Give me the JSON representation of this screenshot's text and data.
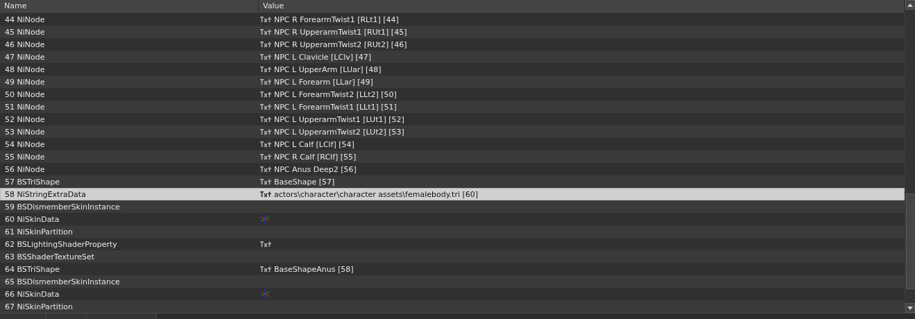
{
  "table": {
    "columns": [
      {
        "label": "Name"
      },
      {
        "label": "Value"
      }
    ],
    "rows": [
      {
        "name": "44 NiNode",
        "kind": "txt",
        "value": "NPC R ForearmTwist1 [RLt1] [44]",
        "selected": false
      },
      {
        "name": "45 NiNode",
        "kind": "txt",
        "value": "NPC R UpperarmTwist1 [RUt1] [45]",
        "selected": false
      },
      {
        "name": "46 NiNode",
        "kind": "txt",
        "value": "NPC R UpperarmTwist2 [RUt2] [46]",
        "selected": false
      },
      {
        "name": "47 NiNode",
        "kind": "txt",
        "value": "NPC L Clavicle [LClv] [47]",
        "selected": false
      },
      {
        "name": "48 NiNode",
        "kind": "txt",
        "value": "NPC L UpperArm [LUar] [48]",
        "selected": false
      },
      {
        "name": "49 NiNode",
        "kind": "txt",
        "value": "NPC L Forearm [LLar] [49]",
        "selected": false
      },
      {
        "name": "50 NiNode",
        "kind": "txt",
        "value": "NPC L ForearmTwist2 [LLt2] [50]",
        "selected": false
      },
      {
        "name": "51 NiNode",
        "kind": "txt",
        "value": "NPC L ForearmTwist1 [LLt1] [51]",
        "selected": false
      },
      {
        "name": "52 NiNode",
        "kind": "txt",
        "value": "NPC L UpperarmTwist1 [LUt1] [52]",
        "selected": false
      },
      {
        "name": "53 NiNode",
        "kind": "txt",
        "value": "NPC L UpperarmTwist2 [LUt2] [53]",
        "selected": false
      },
      {
        "name": "54 NiNode",
        "kind": "txt",
        "value": "NPC L Calf [LClf] [54]",
        "selected": false
      },
      {
        "name": "55 NiNode",
        "kind": "txt",
        "value": "NPC R Calf [RClf] [55]",
        "selected": false
      },
      {
        "name": "56 NiNode",
        "kind": "txt",
        "value": "NPC Anus Deep2 [56]",
        "selected": false
      },
      {
        "name": "57 BSTriShape",
        "kind": "txt",
        "value": "BaseShape [57]",
        "selected": false
      },
      {
        "name": "58 NiStringExtraData",
        "kind": "txt",
        "value": "actors\\character\\character assets\\femalebody.tri [60]",
        "selected": true
      },
      {
        "name": "59 BSDismemberSkinInstance",
        "kind": "plain",
        "selected": false
      },
      {
        "name": "60 NiSkinData",
        "kind": "axes",
        "selected": false
      },
      {
        "name": "61 NiSkinPartition",
        "kind": "plain",
        "selected": false
      },
      {
        "name": "62 BSLightingShaderProperty",
        "kind": "txt",
        "selected": false
      },
      {
        "name": "63 BSShaderTextureSet",
        "kind": "plain",
        "selected": false
      },
      {
        "name": "64 BSTriShape",
        "kind": "txt",
        "value": "BaseShapeAnus [58]",
        "selected": false
      },
      {
        "name": "65 BSDismemberSkinInstance",
        "kind": "plain",
        "selected": false
      },
      {
        "name": "66 NiSkinData",
        "kind": "axes",
        "selected": false
      },
      {
        "name": "67 NiSkinPartition",
        "kind": "plain",
        "selected": false
      }
    ]
  }
}
